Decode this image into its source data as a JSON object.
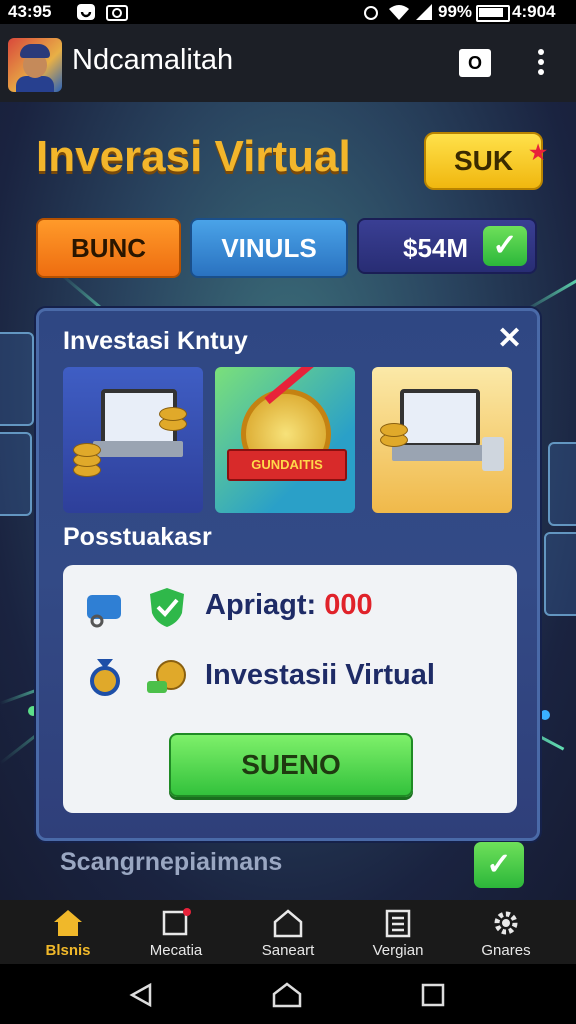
{
  "status_bar": {
    "time": "43:95",
    "battery": "99%",
    "clock_right": "4:904"
  },
  "app_bar": {
    "title": "Ndcamalitah",
    "square_button_label": "O"
  },
  "hero": {
    "title": "Inverasi Virtual",
    "action_button": "SUK"
  },
  "chips": [
    {
      "label": "BUNC"
    },
    {
      "label": "VINULS"
    },
    {
      "label": "$54M"
    }
  ],
  "panel": {
    "title": "Investasi Kntuy",
    "tiles": [
      {
        "icon": "laptop-coins-illustration"
      },
      {
        "icon": "medal-growth-illustration",
        "ribbon": "GUNDAITIS"
      },
      {
        "icon": "laptop-desk-illustration"
      }
    ],
    "section_title": "Posstuakasr",
    "info": {
      "row1_label": "Apriagt: ",
      "row1_amount": "000",
      "row2_label": "Investasii Virtual"
    },
    "button_label": "SUENO"
  },
  "footer_label": "Scangrnepiaimans",
  "bottom_nav": [
    {
      "label": "Blsnis",
      "icon": "home-icon",
      "active": true
    },
    {
      "label": "Mecatia",
      "icon": "notification-square-icon"
    },
    {
      "label": "Saneart",
      "icon": "house-outline-icon"
    },
    {
      "label": "Vergian",
      "icon": "document-icon"
    },
    {
      "label": "Gnares",
      "icon": "gear-icon"
    }
  ],
  "colors": {
    "accent_gold": "#f3b62b",
    "green": "#33c23c",
    "panel": "#334a86"
  }
}
